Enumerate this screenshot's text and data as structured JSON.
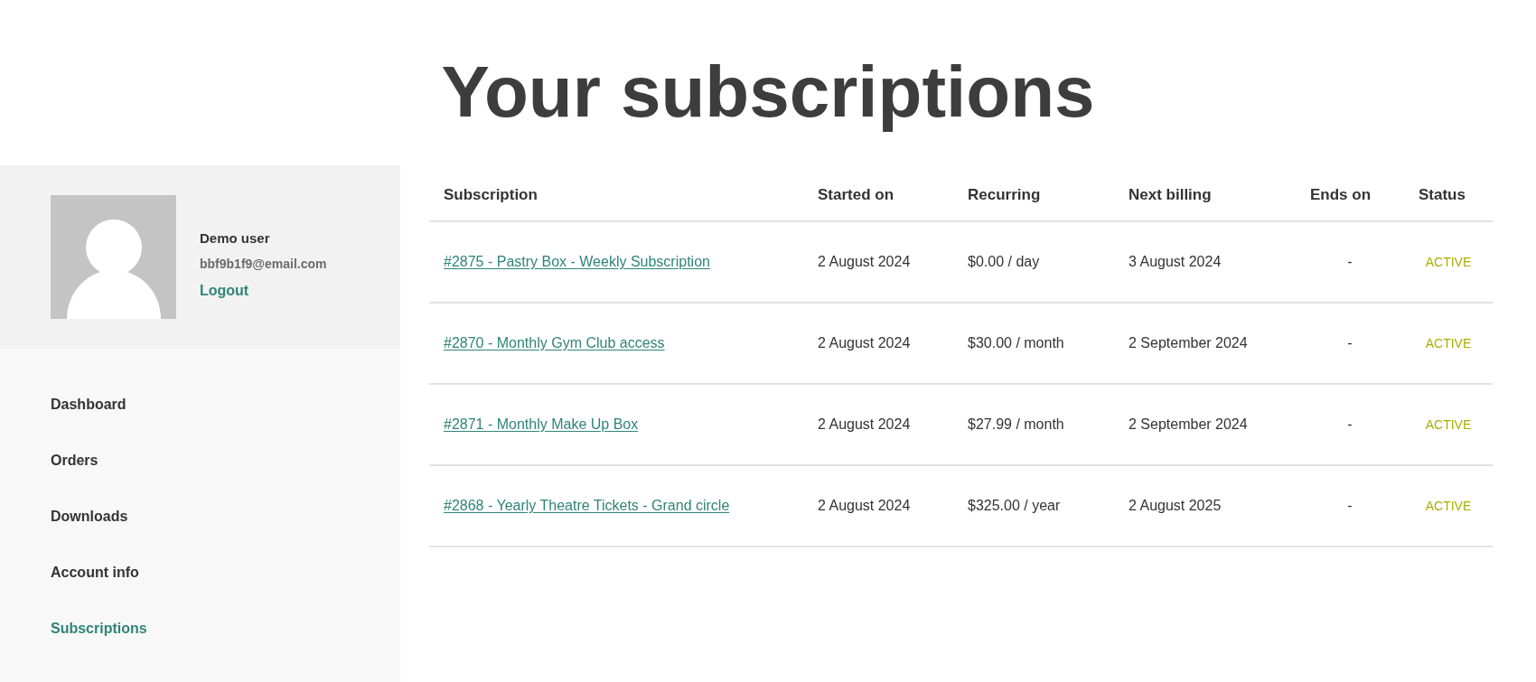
{
  "page": {
    "title": "Your subscriptions"
  },
  "profile": {
    "name": "Demo user",
    "email": "bbf9b1f9@email.com",
    "logout": "Logout"
  },
  "sidebar": {
    "items": [
      {
        "label": "Dashboard",
        "selected": false
      },
      {
        "label": "Orders",
        "selected": false
      },
      {
        "label": "Downloads",
        "selected": false
      },
      {
        "label": "Account info",
        "selected": false
      },
      {
        "label": "Subscriptions",
        "selected": true
      }
    ]
  },
  "table": {
    "columns": [
      "Subscription",
      "Started on",
      "Recurring",
      "Next billing",
      "Ends on",
      "Status"
    ],
    "rows": [
      {
        "subscription": "#2875 - Pastry Box - Weekly Subscription",
        "started_on": "2 August 2024",
        "recurring": "$0.00 / day",
        "next_billing": "3 August 2024",
        "ends_on": "-",
        "status": "ACTIVE"
      },
      {
        "subscription": "#2870 - Monthly Gym Club access",
        "started_on": "2 August 2024",
        "recurring": "$30.00 / month",
        "next_billing": "2 September 2024",
        "ends_on": "-",
        "status": "ACTIVE"
      },
      {
        "subscription": "#2871 - Monthly Make Up Box",
        "started_on": "2 August 2024",
        "recurring": "$27.99 / month",
        "next_billing": "2 September 2024",
        "ends_on": "-",
        "status": "ACTIVE"
      },
      {
        "subscription": "#2868 - Yearly Theatre Tickets - Grand circle",
        "started_on": "2 August 2024",
        "recurring": "$325.00 / year",
        "next_billing": "2 August 2025",
        "ends_on": "-",
        "status": "ACTIVE"
      }
    ]
  }
}
